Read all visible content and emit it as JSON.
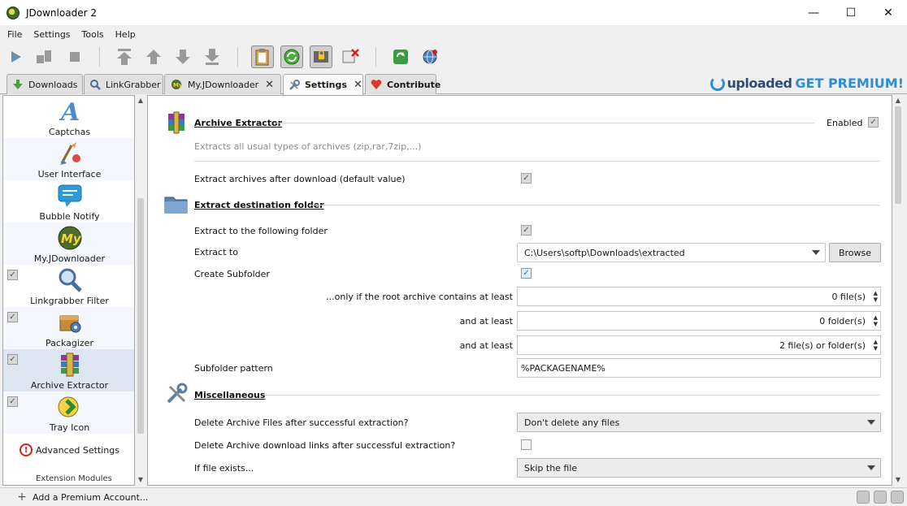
{
  "window": {
    "title": "JDownloader 2"
  },
  "menu": [
    "File",
    "Settings",
    "Tools",
    "Help"
  ],
  "tabs": [
    {
      "label": "Downloads",
      "icon": "download-arrow-icon",
      "closable": false
    },
    {
      "label": "LinkGrabber",
      "icon": "magnifier-icon",
      "closable": false
    },
    {
      "label": "My.JDownloader",
      "icon": "my-jd-icon",
      "closable": true
    },
    {
      "label": "Settings",
      "icon": "wrench-icon",
      "closable": true,
      "active": true
    },
    {
      "label": "Contribute",
      "icon": "heart-icon",
      "closable": false
    }
  ],
  "premium_banner": {
    "brand": "uploaded",
    "cta": "GET PREMIUM!"
  },
  "sidebar": {
    "items": [
      {
        "label": "Captchas",
        "icon": "captcha-icon",
        "checked": null
      },
      {
        "label": "User Interface",
        "icon": "user-interface-icon",
        "checked": null
      },
      {
        "label": "Bubble Notify",
        "icon": "speech-bubble-icon",
        "checked": null
      },
      {
        "label": "My.JDownloader",
        "icon": "my-jd-icon",
        "checked": null
      },
      {
        "label": "Linkgrabber Filter",
        "icon": "filter-magnifier-icon",
        "checked": true
      },
      {
        "label": "Packagizer",
        "icon": "packagizer-icon",
        "checked": true
      },
      {
        "label": "Archive Extractor",
        "icon": "archive-icon",
        "checked": true,
        "selected": true
      },
      {
        "label": "Tray Icon",
        "icon": "tray-icon",
        "checked": true
      }
    ],
    "advanced": "Advanced Settings",
    "extension_partial": "Extension Modules"
  },
  "main": {
    "archive_section": {
      "title": "Archive Extractor",
      "enabled_label": "Enabled",
      "description": "Extracts all usual types of archives (zip,rar,7zip,...)",
      "extract_after_label": "Extract archives after download (default value)"
    },
    "dest_section": {
      "title": "Extract destination folder",
      "extract_to_following_label": "Extract to the following folder",
      "extract_to_label": "Extract to",
      "extract_to_value": "C:\\Users\\softp\\Downloads\\extracted",
      "browse_label": "Browse",
      "create_subfolder_label": "Create Subfolder",
      "root_files_label": "...only if the root archive contains at least",
      "root_files_value": "0 file(s)",
      "and_least_1": "and at least",
      "folders_value": "0 folder(s)",
      "and_least_2": "and at least",
      "files_or_folders_value": "2 file(s) or folder(s)",
      "subfolder_pattern_label": "Subfolder pattern",
      "subfolder_pattern_value": "%PACKAGENAME%"
    },
    "misc_section": {
      "title": "Miscellaneous",
      "delete_files_label": "Delete Archive Files after successful extraction?",
      "delete_files_value": "Don't delete any files",
      "delete_links_label": "Delete Archive download links after successful extraction?",
      "if_exists_label": "If file exists...",
      "if_exists_value": "Skip the file"
    }
  },
  "statusbar": {
    "add_account": "Add a Premium Account..."
  },
  "colors": {
    "accent": "#2c8fd6",
    "selected_row": "#dbe6f2",
    "premium_dark": "#2d4e79"
  }
}
